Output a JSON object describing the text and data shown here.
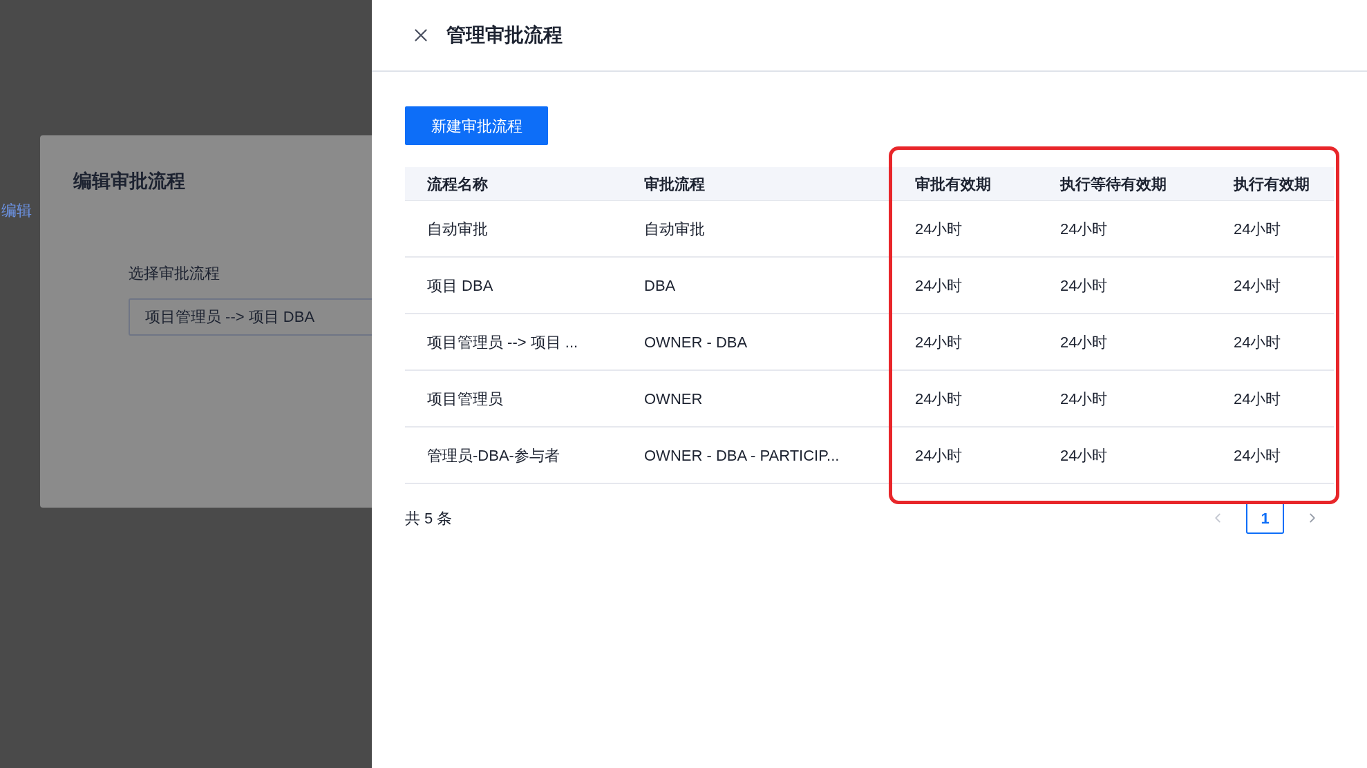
{
  "background": {
    "edit_link": "编辑",
    "modal": {
      "title": "编辑审批流程",
      "field_label": "选择审批流程",
      "field_value": "项目管理员 --> 项目 DBA"
    }
  },
  "drawer": {
    "title": "管理审批流程",
    "new_button": "新建审批流程",
    "table": {
      "columns": [
        "流程名称",
        "审批流程",
        "审批有效期",
        "执行等待有效期",
        "执行有效期"
      ],
      "rows": [
        {
          "cells": [
            "自动审批",
            "自动审批",
            "24小时",
            "24小时",
            "24小时"
          ]
        },
        {
          "cells": [
            "项目 DBA",
            "DBA",
            "24小时",
            "24小时",
            "24小时"
          ]
        },
        {
          "cells": [
            "项目管理员 --> 项目 ...",
            "OWNER - DBA",
            "24小时",
            "24小时",
            "24小时"
          ]
        },
        {
          "cells": [
            "项目管理员",
            "OWNER",
            "24小时",
            "24小时",
            "24小时"
          ]
        },
        {
          "cells": [
            "管理员-DBA-参与者",
            "OWNER - DBA - PARTICIP...",
            "24小时",
            "24小时",
            "24小时"
          ]
        }
      ]
    },
    "total": "共 5 条",
    "pagination": {
      "pages": [
        {
          "label": "1",
          "selected": true
        }
      ]
    }
  }
}
